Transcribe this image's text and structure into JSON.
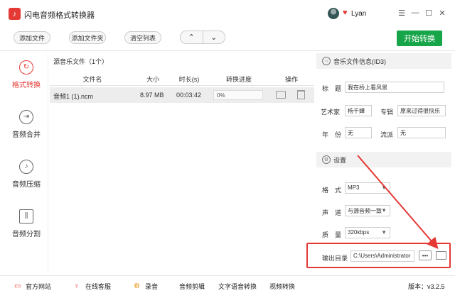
{
  "window": {
    "title": "闪电音频格式转换器",
    "user": "Lyan"
  },
  "toolbar": {
    "add_file": "添加文件",
    "add_folder": "添加文件夹",
    "clear_list": "清空列表",
    "start": "开始转换"
  },
  "sidebar": {
    "items": [
      {
        "label": "格式转换",
        "icon": "refresh-icon",
        "active": true
      },
      {
        "label": "音频合并",
        "icon": "merge-icon"
      },
      {
        "label": "音频压缩",
        "icon": "compress-icon"
      },
      {
        "label": "音频分割",
        "icon": "split-icon"
      }
    ]
  },
  "filelist": {
    "header": "源音乐文件（1个）",
    "columns": [
      "文件名",
      "大小",
      "时长(s)",
      "转换进度",
      "操作"
    ],
    "rows": [
      {
        "name": "音频1 (1).ncm",
        "size": "8.97 MB",
        "duration": "00:03:42",
        "progress": "0%"
      }
    ]
  },
  "id3": {
    "header": "音乐文件信息(ID3)",
    "title_label": "标　题",
    "title_value": "我在桥上看风景",
    "artist_label": "艺术家",
    "artist_value": "杨千嬅",
    "album_label": "专辑",
    "album_value": "原来过得很快乐",
    "year_label": "年　份",
    "year_value": "无",
    "genre_label": "流派",
    "genre_value": "无"
  },
  "settings": {
    "header": "设置",
    "format_label": "格　式",
    "format_value": "MP3",
    "channel_label": "声　道",
    "channel_value": "与源音频一致",
    "quality_label": "质　量",
    "quality_value": "320kbps",
    "output_label": "输出目录",
    "output_value": "C:\\Users\\Administrator",
    "browse": "•••"
  },
  "bottom": {
    "website": "官方网站",
    "support": "在线客服",
    "record": "录音",
    "audio_cut": "音频剪辑",
    "tts": "文字语音转换",
    "video_convert": "视频转换",
    "version": "版本：v3.2.5"
  },
  "colors": {
    "accent": "#e53935",
    "start": "#17a54a"
  }
}
